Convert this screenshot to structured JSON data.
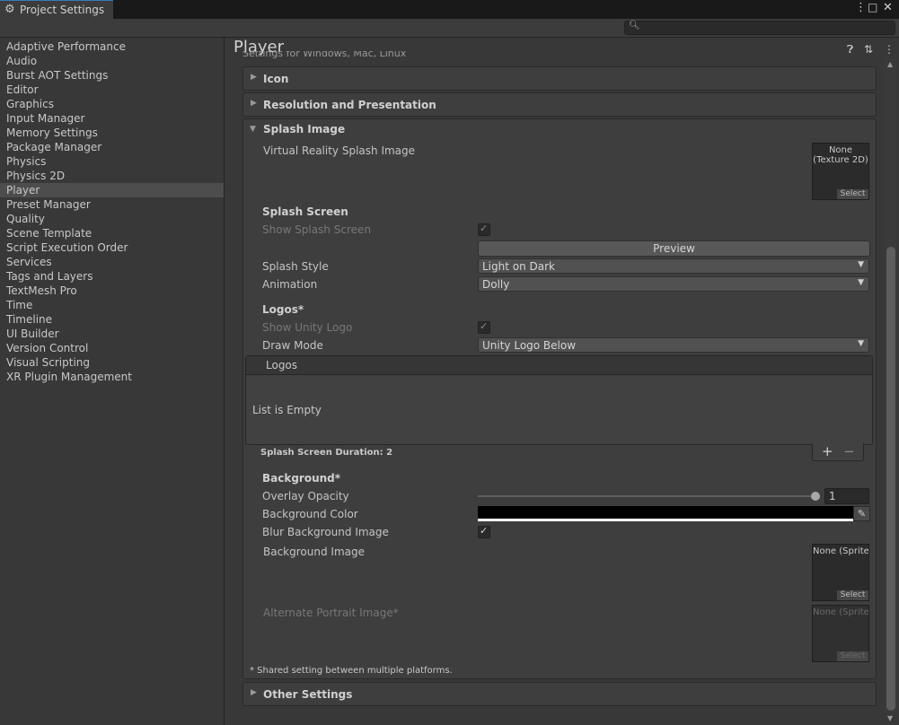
{
  "window": {
    "tab_title": "Project Settings",
    "more_icon": "kebab-menu-icon",
    "maximize_icon": "maximize-icon",
    "close_icon": "close-icon"
  },
  "search": {
    "placeholder": "",
    "value": ""
  },
  "sidebar": {
    "items": [
      {
        "label": "Adaptive Performance"
      },
      {
        "label": "Audio"
      },
      {
        "label": "Burst AOT Settings"
      },
      {
        "label": "Editor"
      },
      {
        "label": "Graphics"
      },
      {
        "label": "Input Manager"
      },
      {
        "label": "Memory Settings"
      },
      {
        "label": "Package Manager"
      },
      {
        "label": "Physics"
      },
      {
        "label": "Physics 2D"
      },
      {
        "label": "Player",
        "selected": true
      },
      {
        "label": "Preset Manager"
      },
      {
        "label": "Quality"
      },
      {
        "label": "Scene Template"
      },
      {
        "label": "Script Execution Order"
      },
      {
        "label": "Services"
      },
      {
        "label": "Tags and Layers"
      },
      {
        "label": "TextMesh Pro"
      },
      {
        "label": "Time"
      },
      {
        "label": "Timeline"
      },
      {
        "label": "UI Builder"
      },
      {
        "label": "Version Control"
      },
      {
        "label": "Visual Scripting"
      },
      {
        "label": "XR Plugin Management"
      }
    ]
  },
  "main": {
    "title": "Player",
    "cut_off_text": "Settings for Windows, Mac, Linux",
    "sections": {
      "icon": "Icon",
      "resolution": "Resolution and Presentation",
      "splash": "Splash Image",
      "other": "Other Settings"
    },
    "splash": {
      "vr_splash_label": "Virtual Reality Splash Image",
      "vr_splash_value": "None\n(Texture 2D)",
      "select_label": "Select",
      "splash_screen_heading": "Splash Screen",
      "show_splash_label": "Show Splash Screen",
      "show_splash_checked": true,
      "preview_label": "Preview",
      "splash_style_label": "Splash Style",
      "splash_style_value": "Light on Dark",
      "animation_label": "Animation",
      "animation_value": "Dolly",
      "logos_heading": "Logos*",
      "show_unity_logo_label": "Show Unity Logo",
      "show_unity_logo_checked": true,
      "draw_mode_label": "Draw Mode",
      "draw_mode_value": "Unity Logo Below",
      "logos_list_header": "Logos",
      "logos_list_empty": "List is Empty",
      "add_symbol": "+",
      "remove_symbol": "−",
      "duration_label": "Splash Screen Duration: 2",
      "background_heading": "Background*",
      "overlay_opacity_label": "Overlay Opacity",
      "overlay_opacity_value": "1",
      "background_color_label": "Background Color",
      "background_color": "#000000",
      "blur_label": "Blur Background Image",
      "blur_checked": true,
      "background_image_label": "Background Image",
      "background_image_value": "None (Sprite)",
      "alt_portrait_label": "Alternate Portrait Image*",
      "alt_portrait_value": "None (Sprite)",
      "shared_note": "* Shared setting between multiple platforms."
    }
  }
}
